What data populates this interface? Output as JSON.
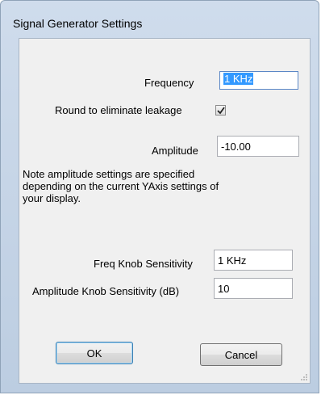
{
  "window": {
    "title": "Signal Generator Settings"
  },
  "form": {
    "frequency_label": "Frequency",
    "frequency_value": "1 KHz",
    "round_label": "Round to eliminate leakage",
    "round_checked": true,
    "amplitude_label": "Amplitude",
    "amplitude_value": "-10.00",
    "note": "Note amplitude settings are specified\ndepending on the current YAxis settings of\nyour display.",
    "freq_knob_label": "Freq Knob Sensitivity",
    "freq_knob_value": "1 KHz",
    "amp_knob_label": "Amplitude Knob Sensitivity (dB)",
    "amp_knob_value": "10"
  },
  "buttons": {
    "ok_label": "OK",
    "cancel_label": "Cancel"
  },
  "colors": {
    "title_bar": "#cfdcec",
    "client_bg": "#f0f0f0",
    "selection": "#3399ff",
    "default_button_border": "#3c7fb1"
  }
}
